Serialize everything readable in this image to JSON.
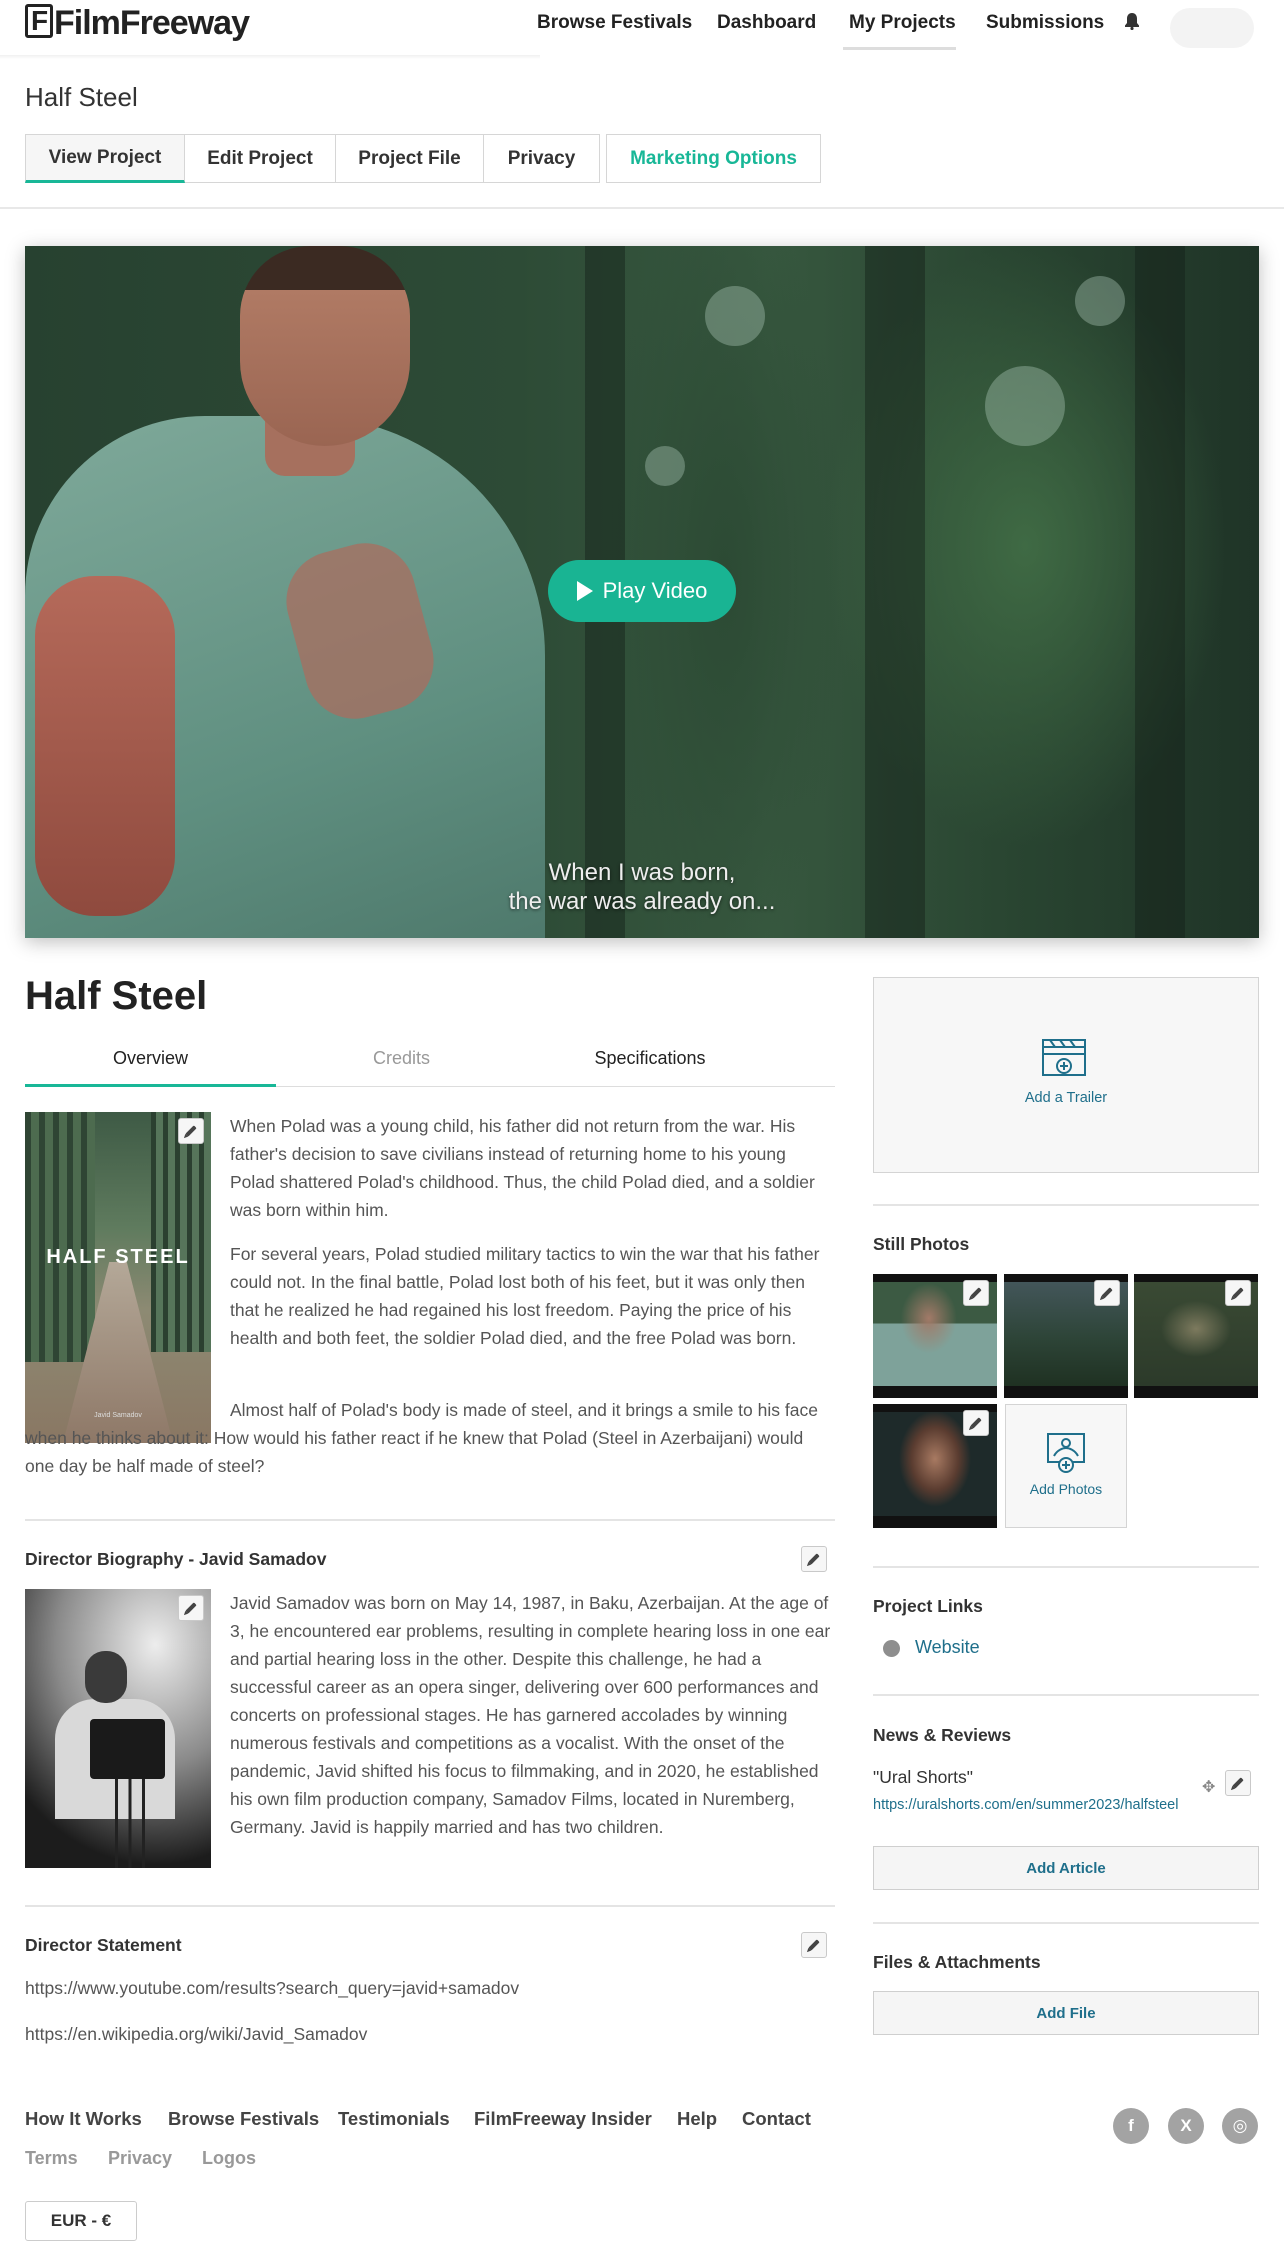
{
  "header": {
    "logo": "FilmFreeway",
    "nav": [
      "Browse Festivals",
      "Dashboard",
      "My Projects",
      "Submissions"
    ]
  },
  "project": {
    "page_title": "Half Steel",
    "tabs": [
      "View Project",
      "Edit Project",
      "Project File",
      "Privacy",
      "Marketing Options"
    ]
  },
  "video": {
    "play_label": "Play Video",
    "subtitle_line1": "When I was born,",
    "subtitle_line2": "the war was already on..."
  },
  "film": {
    "title": "Half Steel",
    "subtabs": [
      "Overview",
      "Credits",
      "Specifications"
    ],
    "poster_title": "HALF STEEL",
    "poster_credit": "Javid Samadov",
    "synopsis": [
      "When Polad was a young child, his father did not return from the war. His father's decision to save civilians instead of returning home to his young Polad shattered Polad's childhood. Thus, the child Polad died, and a soldier was born within him.",
      "For several years, Polad studied military tactics to win the war that his father could not. In the final battle, Polad lost both of his feet, but it was only then that he realized he had regained his lost freedom. Paying the price of his health and both feet, the soldier Polad died, and the free Polad was born.",
      "Almost half of Polad's body is made of steel, and it brings a smile to his face when he thinks about it: How would his father react if he knew that Polad (Steel in Azerbaijani) would one day be half made of steel?"
    ]
  },
  "director_bio": {
    "heading": "Director Biography - Javid Samadov",
    "text": "Javid Samadov was born on May 14, 1987, in Baku, Azerbaijan. At the age of 3, he encountered ear problems, resulting in complete hearing loss in one ear and partial hearing loss in the other. Despite this challenge, he had a successful career as an opera singer, delivering over 600 performances and concerts on professional stages. He has garnered accolades by winning numerous festivals and competitions as a vocalist. With the onset of the pandemic, Javid shifted his focus to filmmaking, and in 2020, he established his own film production company, Samadov Films, located in Nuremberg, Germany. Javid is happily married and has two children."
  },
  "director_statement": {
    "heading": "Director Statement",
    "links": [
      "https://www.youtube.com/results?search_query=javid+samadov",
      "https://en.wikipedia.org/wiki/Javid_Samadov"
    ]
  },
  "sidebar": {
    "add_trailer": "Add a Trailer",
    "still_photos_heading": "Still Photos",
    "add_photos": "Add Photos",
    "project_links_heading": "Project Links",
    "website": "Website",
    "news_heading": "News & Reviews",
    "news_title": "\"Ural Shorts\"",
    "news_url": "https://uralshorts.com/en/summer2023/halfsteel",
    "add_article": "Add Article",
    "files_heading": "Files & Attachments",
    "add_file": "Add File"
  },
  "footer": {
    "nav": [
      "How It Works",
      "Browse Festivals",
      "Testimonials",
      "FilmFreeway Insider",
      "Help",
      "Contact"
    ],
    "sub": [
      "Terms",
      "Privacy",
      "Logos"
    ],
    "currency": "EUR - €",
    "social": [
      "f",
      "X",
      "◎"
    ]
  },
  "colors": {
    "accent": "#18b797",
    "link": "#1f6f8b"
  }
}
